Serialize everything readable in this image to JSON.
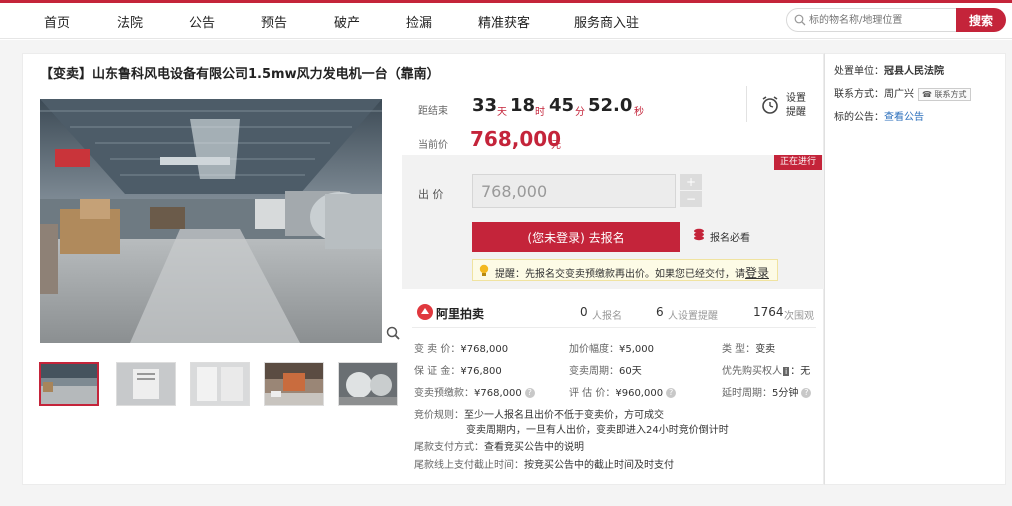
{
  "nav": {
    "items": [
      "首页",
      "法院",
      "公告",
      "预告",
      "破产",
      "捡漏",
      "精准获客",
      "服务商入驻"
    ],
    "search_placeholder": "标的物名称/地理位置",
    "search_button": "搜索"
  },
  "colors": {
    "brand": "#c4243a",
    "link": "#2a6ebb"
  },
  "listing": {
    "title": "【变卖】山东鲁科风电设备有限公司1.5mw风力发电机一台（靠南）",
    "countdown_label": "距结束",
    "countdown": {
      "days": "33",
      "days_unit": "天",
      "hours": "18",
      "hours_unit": "时",
      "minutes": "45",
      "minutes_unit": "分",
      "seconds": "52.0",
      "seconds_unit": "秒"
    },
    "current_price_label": "当前价",
    "current_price": "768,000",
    "price_unit": "元",
    "remind_label": "设置提醒",
    "status": "正在进行",
    "bid_label": "出 价",
    "bid_value": "768,000",
    "step_up": "+",
    "step_down": "−",
    "signup_button": "(您未登录) 去报名",
    "must_read": "报名必看",
    "tip": "提醒：先报名交变卖预缴款再出价。如果您已经交付，请",
    "tip_login": "登录",
    "zoom_icon": "magnifier-icon"
  },
  "stats": {
    "platform": "阿里拍卖",
    "signups": "0",
    "signups_label": "人报名",
    "reminders": "6",
    "reminders_label": "人设置提醒",
    "views": "1764",
    "views_label": "次围观"
  },
  "details": {
    "price": {
      "k": "变 卖 价：",
      "v": "¥768,000"
    },
    "deposit": {
      "k": "保 证 金：",
      "v": "¥76,800"
    },
    "prepay": {
      "k": "变卖预缴款：",
      "v": "¥768,000"
    },
    "increment": {
      "k": "加价幅度：",
      "v": "¥5,000"
    },
    "period": {
      "k": "变卖周期：",
      "v": "60天"
    },
    "appraisal": {
      "k": "评 估 价：",
      "v": "¥960,000"
    },
    "type": {
      "k": "类    型：",
      "v": "变卖"
    },
    "priority": {
      "k": "优先购买权人",
      "badge": "i",
      "v": "：无"
    },
    "delay": {
      "k": "延时周期：",
      "v": "5分钟"
    },
    "rule_k": "竞价规则：",
    "rule_1": "至少一人报名且出价不低于变卖价，方可成交",
    "rule_2": "变卖周期内，一旦有人出价，变卖即进入24小时竞价倒计时",
    "final_pay_k": "尾款支付方式：",
    "final_pay_v": "查看竞买公告中的说明",
    "final_online_k": "尾款线上支付截止时间：",
    "final_online_v": "按竞买公告中的截止时间及时支付"
  },
  "side": {
    "unit_k": "处置单位：",
    "unit_v": "冠县人民法院",
    "contact_k": "联系方式：",
    "contact_v": "周广兴",
    "contact_tag": "联系方式",
    "notice_k": "标的公告：",
    "notice_v": "查看公告"
  }
}
